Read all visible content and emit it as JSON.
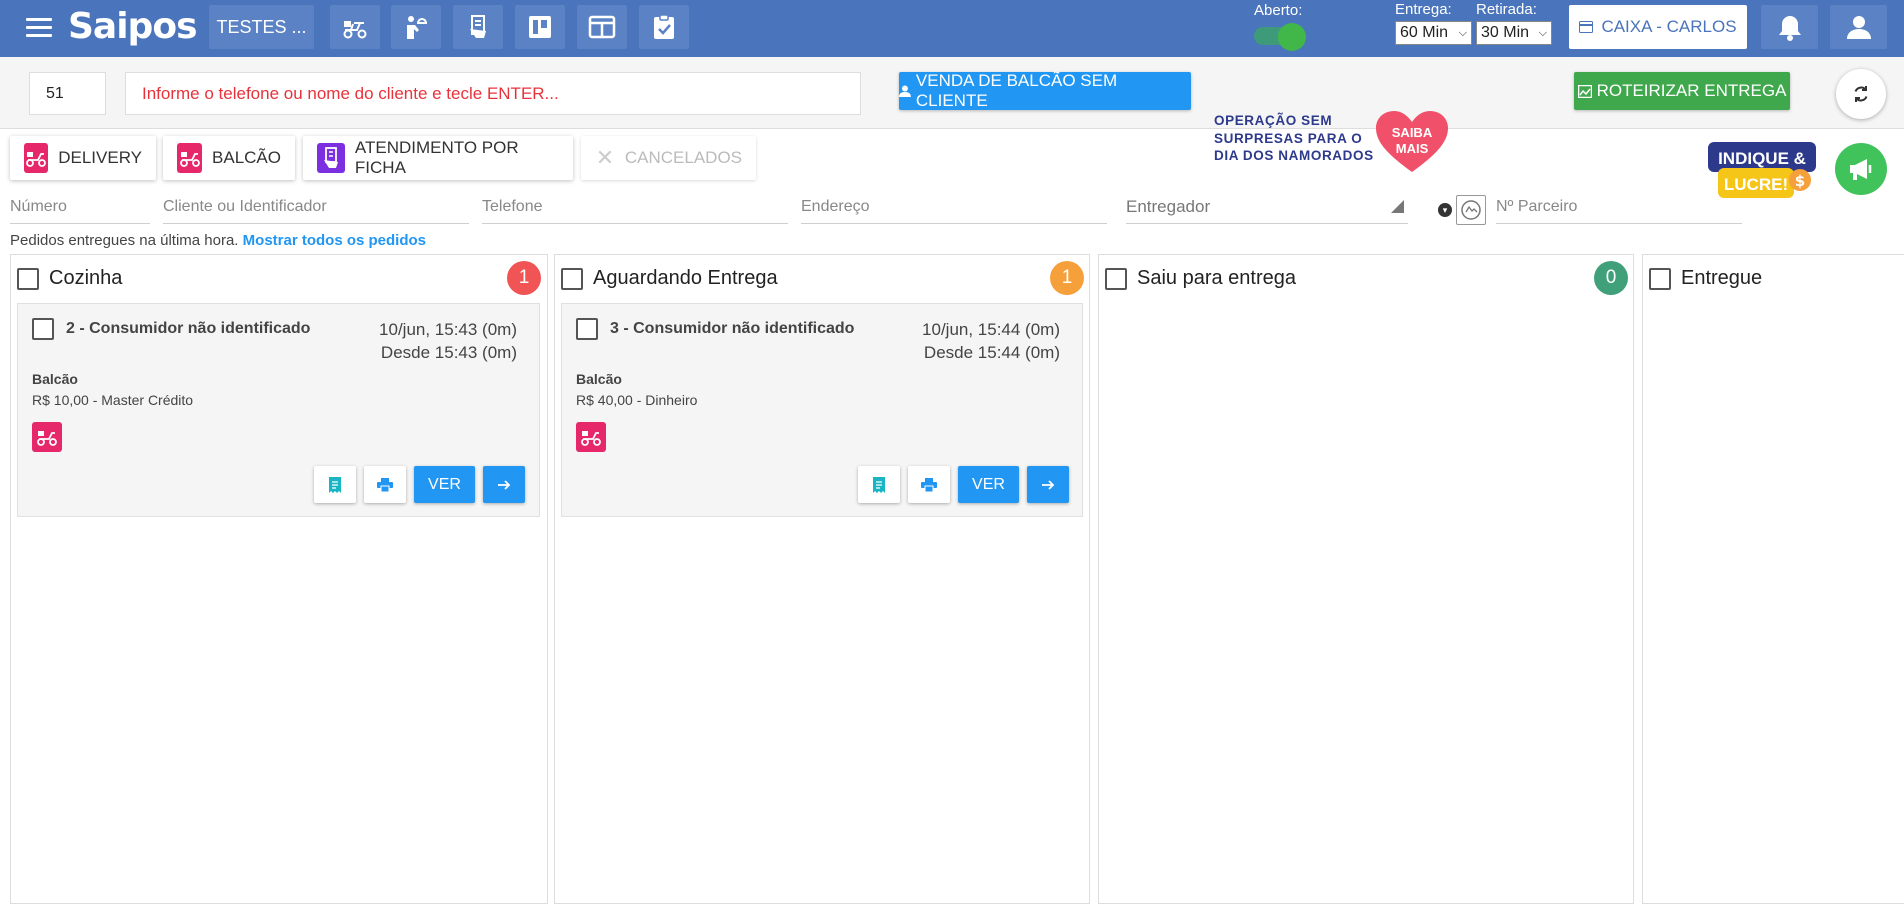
{
  "topbar": {
    "logo": "Saipos",
    "store": "TESTES ...",
    "aberto_label": "Aberto:",
    "entrega_label": "Entrega:",
    "entrega_value": "60 Min",
    "retirada_label": "Retirada:",
    "retirada_value": "30 Min",
    "caixa": "CAIXA - CARLOS",
    "brand_color": "#4a74bb"
  },
  "search": {
    "number": "51",
    "client_placeholder": "Informe o telefone ou nome do cliente e tecle ENTER...",
    "venda_button": "VENDA DE BALCÃO SEM CLIENTE",
    "rota_button": "ROTEIRIZAR ENTREGA"
  },
  "tabs": [
    {
      "label": "DELIVERY"
    },
    {
      "label": "BALCÃO"
    },
    {
      "label": "ATENDIMENTO POR FICHA"
    },
    {
      "label": "CANCELADOS"
    }
  ],
  "promo": {
    "line1": "OPERAÇÃO SEM",
    "line2": "SURPRESAS PARA O",
    "line3": "DIA DOS NAMORADOS",
    "heart_line1": "SAIBA",
    "heart_line2": "MAIS",
    "indique_line1": "INDIQUE &",
    "indique_line2": "LUCRE!"
  },
  "filters": {
    "numero": "Número",
    "cliente": "Cliente ou Identificador",
    "telefone": "Telefone",
    "endereco": "Endereço",
    "entregador": "Entregador",
    "parceiro": "Nº Parceiro"
  },
  "info": {
    "text": "Pedidos entregues na última hora.",
    "link": "Mostrar todos os pedidos"
  },
  "columns": [
    {
      "title": "Cozinha",
      "count": "1",
      "color": "#f05454"
    },
    {
      "title": "Aguardando Entrega",
      "count": "1",
      "color": "#f5a03a"
    },
    {
      "title": "Saiu para entrega",
      "count": "0",
      "color": "#3fa079"
    },
    {
      "title": "Entregue"
    }
  ],
  "orders": [
    {
      "title": "2 - Consumidor não identificado",
      "date": "10/jun, 15:43 (0m)",
      "since": "Desde 15:43 (0m)",
      "type": "Balcão",
      "payment": "R$ 10,00 - Master Crédito",
      "ver": "VER"
    },
    {
      "title": "3 - Consumidor não identificado",
      "date": "10/jun, 15:44 (0m)",
      "since": "Desde 15:44 (0m)",
      "type": "Balcão",
      "payment": "R$ 40,00 - Dinheiro",
      "ver": "VER"
    }
  ]
}
